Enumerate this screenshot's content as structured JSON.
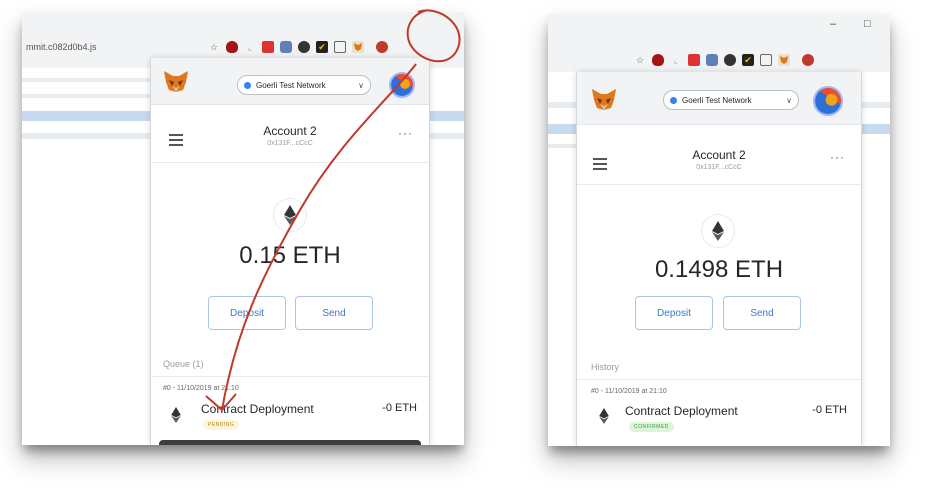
{
  "left": {
    "url_fragment": "mmit.c082d0b4.js",
    "popup": {
      "network": "Goerli Test Network",
      "account_name": "Account 2",
      "account_address": "0x131F...cCcC",
      "balance": "0.15 ETH",
      "deposit_label": "Deposit",
      "send_label": "Send",
      "section_label": "Queue (1)",
      "tx": {
        "date": "#0 - 11/10/2019 at 21:10",
        "title": "Contract Deployment",
        "amount": "-0 ETH",
        "status": "PENDING"
      }
    }
  },
  "right": {
    "window_controls": {
      "minimize": "–",
      "maximize": "□"
    },
    "popup": {
      "network": "Goerli Test Network",
      "account_name": "Account 2",
      "account_address": "0x131F...cCcC",
      "balance": "0.1498 ETH",
      "deposit_label": "Deposit",
      "send_label": "Send",
      "section_label": "History",
      "tx": {
        "date": "#0 - 11/10/2019 at 21:10",
        "title": "Contract Deployment",
        "amount": "-0 ETH",
        "status": "CONFIRMED"
      }
    }
  },
  "annotation": {
    "color": "#c0392b"
  },
  "icons": [
    "star-icon",
    "ublock-icon",
    "metamask-fox-icon",
    "ethereum-icon",
    "menu-icon",
    "kebab-menu-icon",
    "network-dot-icon",
    "chevron-down-icon",
    "account-identicon"
  ]
}
